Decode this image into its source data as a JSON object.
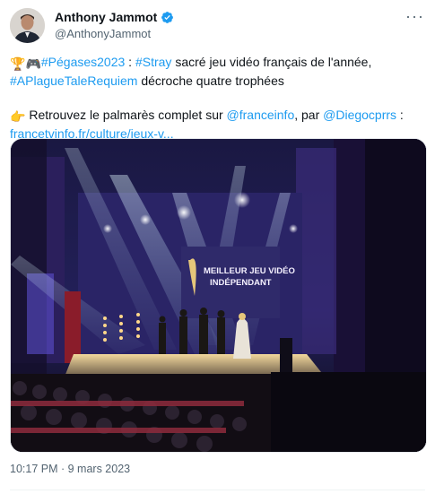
{
  "author": {
    "name": "Anthony Jammot",
    "handle": "@AnthonyJammot",
    "verified": true,
    "avatar_icon": "person-photo-icon"
  },
  "more_icon": "more-options-icon",
  "tweet": {
    "line1_hashtag1": "#Pégases2023",
    "line1_mid": " : ",
    "line1_hashtag2": "#Stray",
    "line1_text": " sacré jeu vidéo français de l'année,",
    "line2_hashtag": "#APlagueTaleRequiem",
    "line2_text": " décroche quatre trophées",
    "line3_text": " Retrouvez le palmarès complet sur ",
    "line3_mention1": "@franceinfo",
    "line3_mid": ", par ",
    "line3_mention2": "@Diegocprrs",
    "line3_end": " :",
    "link": "francetvinfo.fr/culture/jeux-v..."
  },
  "media": {
    "screen_line1": "MEILLEUR JEU VIDÉO",
    "screen_line2": "INDÉPENDANT"
  },
  "meta": {
    "time": "10:17 PM",
    "separator": " · ",
    "date": "9 mars 2023"
  },
  "colors": {
    "link": "#1d9bf0",
    "verified": "#1d9bf0",
    "secondary_text": "#536471"
  }
}
